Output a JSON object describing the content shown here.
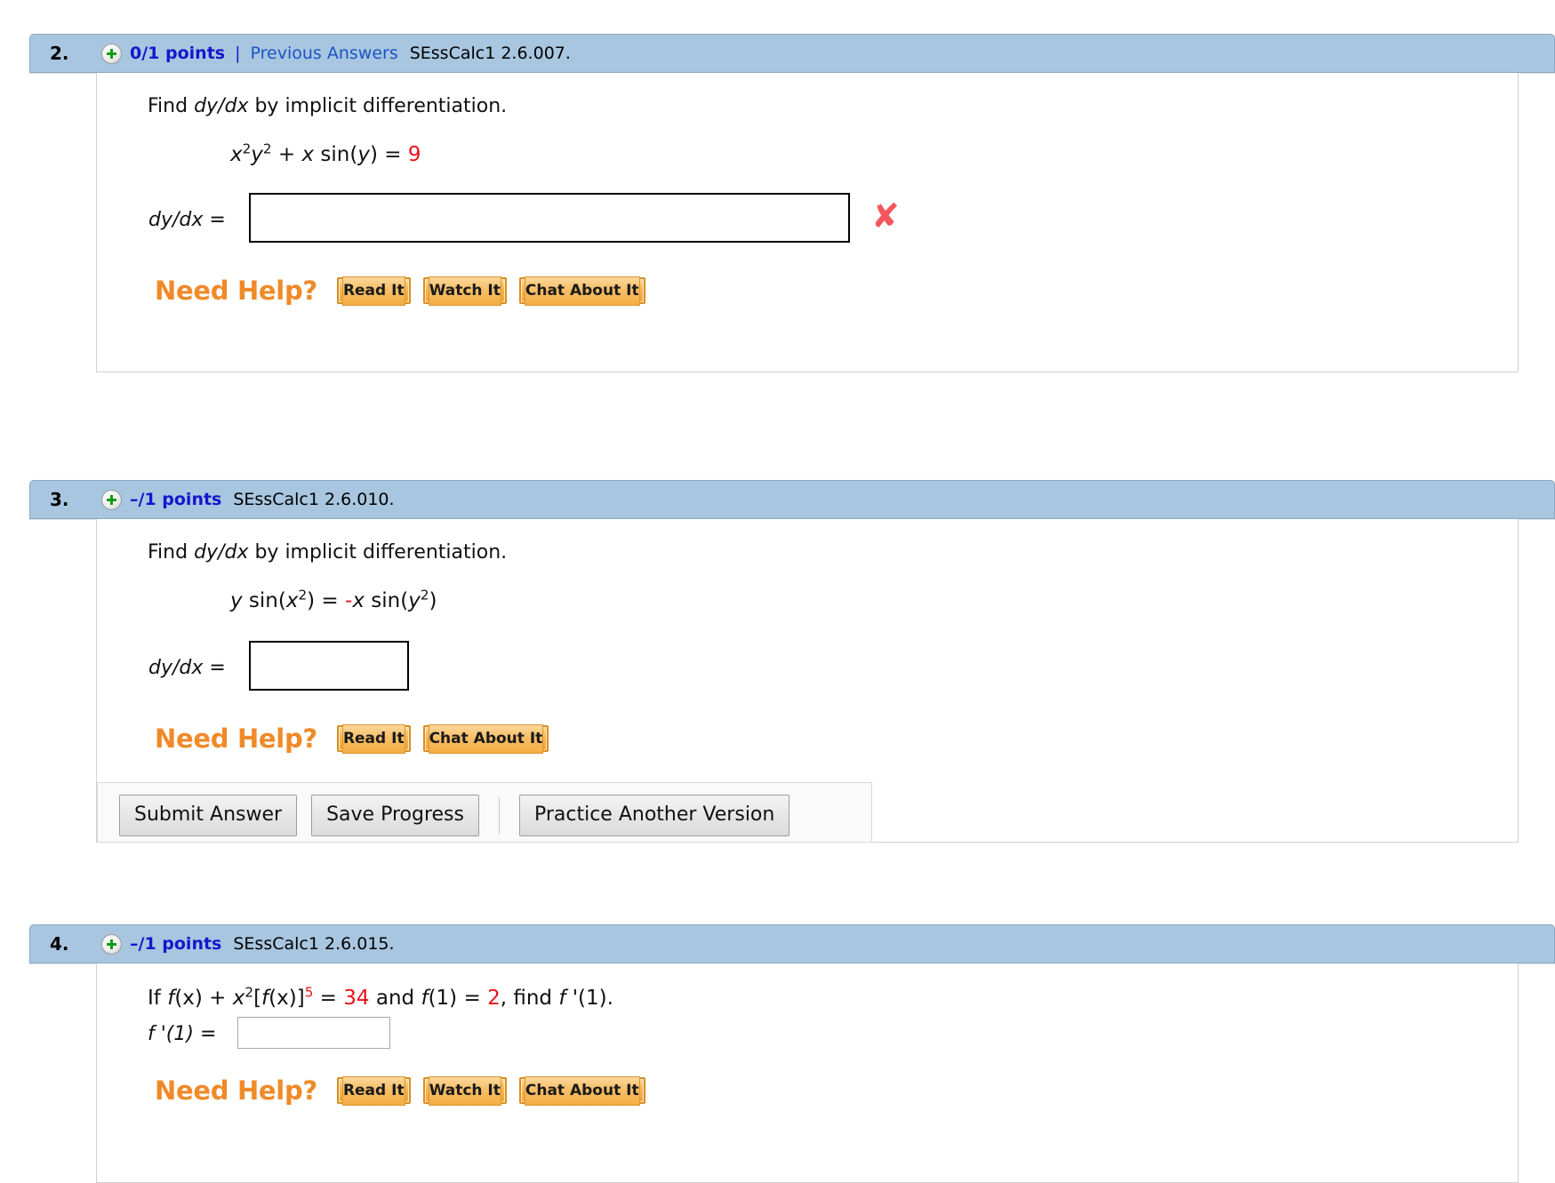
{
  "questions": [
    {
      "number": "2.",
      "points": "0/1 points",
      "separator": "|",
      "previous_answers": "Previous Answers",
      "code": "SEssCalc1 2.6.007.",
      "prompt_plain": "Find dy/dx by implicit differentiation.",
      "prompt_parts": {
        "lead": "Find ",
        "italic": "dy/dx",
        "tail": " by implicit differentiation."
      },
      "equation": {
        "plain": "x2y2 + x sin(y) = 9",
        "base_x": "x",
        "exp_x": "2",
        "base_y": "y",
        "exp_y": "2",
        "middle": " + ",
        "term_x": "x",
        "sin_open": " sin(",
        "sin_arg": "y",
        "sin_close": ")",
        "equals": " = ",
        "rhs": "9"
      },
      "answer_label": "dy/dx =",
      "answer_value": "",
      "answer_status": "incorrect",
      "status_icon": "x-mark-icon",
      "need_help_label": "Need Help?",
      "help_buttons": [
        "Read It",
        "Watch It",
        "Chat About It"
      ],
      "action_buttons": []
    },
    {
      "number": "3.",
      "points": "–/1 points",
      "separator": "",
      "previous_answers": "",
      "code": "SEssCalc1 2.6.010.",
      "prompt_plain": "Find dy/dx by implicit differentiation.",
      "prompt_parts": {
        "lead": "Find ",
        "italic": "dy/dx",
        "tail": " by implicit differentiation."
      },
      "equation": {
        "plain": "y sin(x2) = -x sin(y2)",
        "lhs_var": "y",
        "lhs_sin": " sin(",
        "lhs_arg": "x",
        "lhs_exp": "2",
        "lhs_close": ")",
        "equals": " = ",
        "sign": "-",
        "rhs_var": "x",
        "rhs_sin": " sin(",
        "rhs_arg": "y",
        "rhs_exp": "2",
        "rhs_close": ")"
      },
      "answer_label": "dy/dx =",
      "answer_value": "",
      "answer_status": "none",
      "need_help_label": "Need Help?",
      "help_buttons": [
        "Read It",
        "Chat About It"
      ],
      "action_buttons": [
        "Submit Answer",
        "Save Progress",
        "Practice Another Version"
      ]
    },
    {
      "number": "4.",
      "points": "–/1 points",
      "separator": "",
      "previous_answers": "",
      "code": "SEssCalc1 2.6.015.",
      "prompt_plain": "If f(x) + x2[f(x)]5 = 34 and f(1) = 2, find f '(1).",
      "statement": {
        "lead": "If  ",
        "fx1": "f",
        "paren1": "(x)",
        "plus": " + ",
        "x_base": "x",
        "x_exp": "2",
        "bracket_open": "[",
        "fx2": "f",
        "paren2": "(x)",
        "bracket_close": "]",
        "power": "5",
        "equals1": " = ",
        "val1": "34",
        "and": " and ",
        "fx3": "f",
        "paren3": "(1)",
        "equals2": " = ",
        "val2": "2",
        "comma_find": ",  find ",
        "fprime": "f",
        "prime_arg": " '(1)."
      },
      "answer_label": "f '(1) =",
      "answer_value": "",
      "answer_status": "none",
      "need_help_label": "Need Help?",
      "help_buttons": [
        "Read It",
        "Watch It",
        "Chat About It"
      ],
      "action_buttons": []
    }
  ],
  "colors": {
    "header_bar": "#a8c6e0",
    "points_text": "#1616cd",
    "link_text": "#1b54c4",
    "red_value": "#e8121b",
    "need_help_orange": "#f08a28",
    "x_mark": "#f4565e",
    "help_button": "#f6b44f"
  },
  "icons": {
    "plus_circle": "plus-circle-icon",
    "x_mark": "x-mark-icon"
  }
}
